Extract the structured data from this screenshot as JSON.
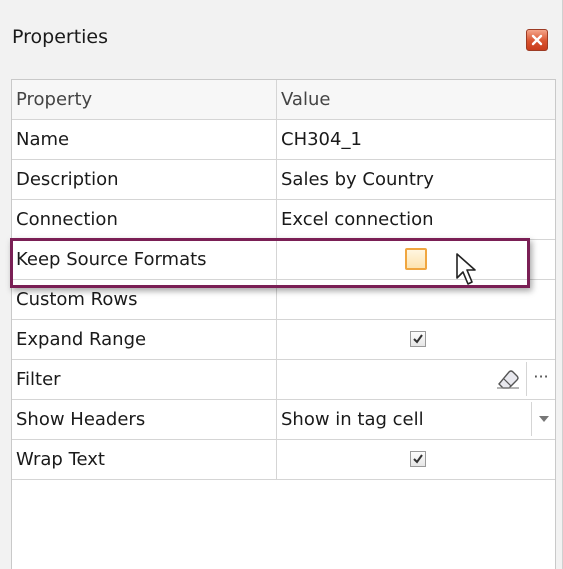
{
  "panel": {
    "title": "Properties",
    "close_icon": "close-icon",
    "close_color": "#d9532f"
  },
  "grid": {
    "columns": [
      "Property",
      "Value"
    ],
    "rows": [
      {
        "name": "Name",
        "value": "CH304_1",
        "editor": "text"
      },
      {
        "name": "Description",
        "value": "Sales by Country",
        "editor": "text"
      },
      {
        "name": "Connection",
        "value": "Excel connection",
        "editor": "text"
      },
      {
        "name": "Keep Source Formats",
        "value": "",
        "editor": "checkbox",
        "checked": false,
        "hovered": true
      },
      {
        "name": "Custom Rows",
        "value": "",
        "editor": "text"
      },
      {
        "name": "Expand Range",
        "value": "",
        "editor": "checkbox",
        "checked": true
      },
      {
        "name": "Filter",
        "value": "",
        "editor": "eraser-ellipsis",
        "ellipsis": "···"
      },
      {
        "name": "Show Headers",
        "value": "Show in tag cell",
        "editor": "dropdown"
      },
      {
        "name": "Wrap Text",
        "value": "",
        "editor": "checkbox",
        "checked": true
      }
    ]
  },
  "highlight_color": "#7a1f55",
  "icons": {
    "eraser": "eraser-icon",
    "dropdown": "dropdown-arrow-icon",
    "cursor": "mouse-pointer-icon",
    "check": "checkmark-icon"
  }
}
